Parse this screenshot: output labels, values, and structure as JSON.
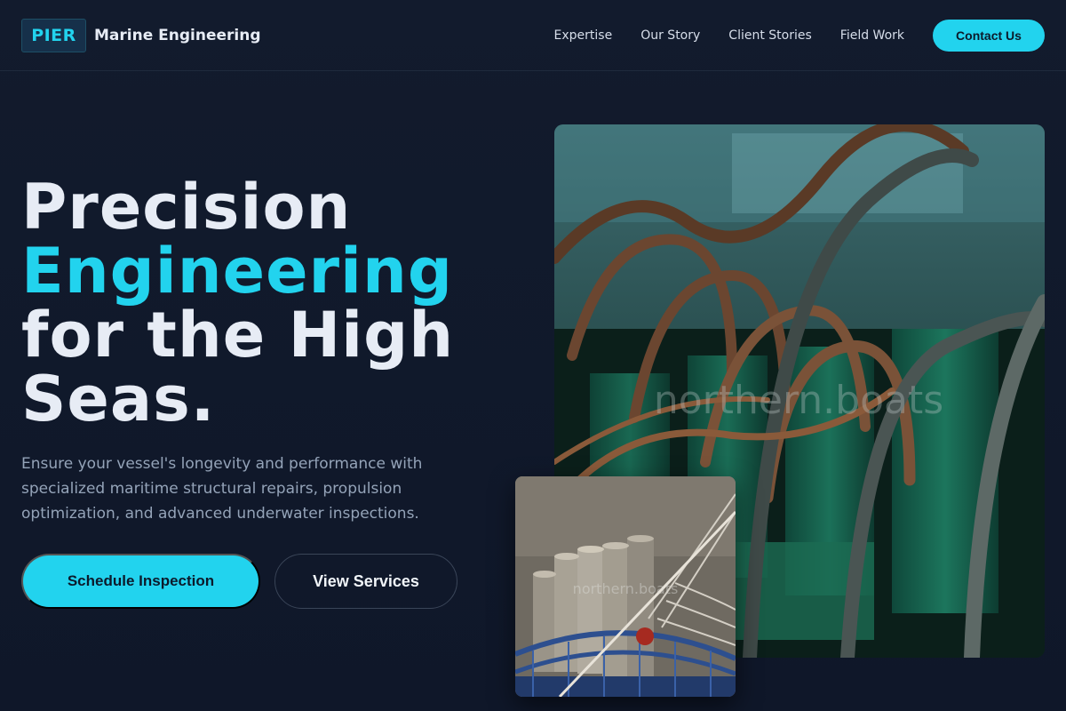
{
  "header": {
    "logo_text": "PIER",
    "brand_name": "Marine Engineering",
    "nav": [
      "Expertise",
      "Our Story",
      "Client Stories",
      "Field Work"
    ],
    "contact_label": "Contact Us"
  },
  "hero": {
    "title_line1": "Precision",
    "title_line2": "Engineering",
    "title_line3": "for the High",
    "title_line4": "Seas.",
    "subtitle": "Ensure your vessel's longevity and performance with specialized maritime structural repairs, propulsion optimization, and advanced underwater inspections.",
    "primary_cta": "Schedule Inspection",
    "secondary_cta": "View Services"
  },
  "images": {
    "main_watermark": "northern.boats",
    "secondary_watermark": "northern.boats"
  },
  "colors": {
    "accent": "#22d3ee",
    "background": "#111a2c",
    "text": "#e7ecf5",
    "muted": "#94a3b8"
  }
}
